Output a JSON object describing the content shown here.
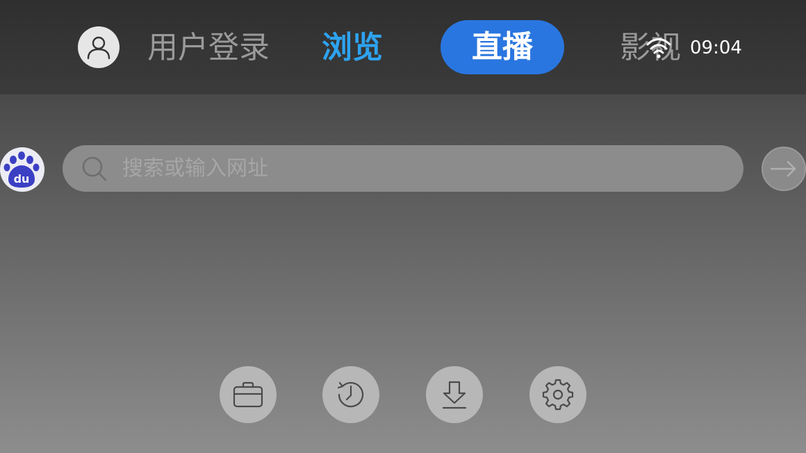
{
  "nav": {
    "login": "用户登录",
    "browse": "浏览",
    "live": "直播",
    "video": "影视"
  },
  "status": {
    "time": "09:04",
    "wifi_icon": "wifi-icon"
  },
  "search": {
    "placeholder": "搜索或输入网址",
    "value": "",
    "engine_icon": "baidu-logo-icon"
  },
  "quick_actions": {
    "files_icon": "briefcase-icon",
    "history_icon": "history-clock-icon",
    "download_icon": "download-icon",
    "settings_icon": "gear-icon"
  },
  "colors": {
    "accent_blue": "#2ea3f0",
    "live_pill": "#2a76e0",
    "baidu_blue": "#3b3fc4"
  }
}
